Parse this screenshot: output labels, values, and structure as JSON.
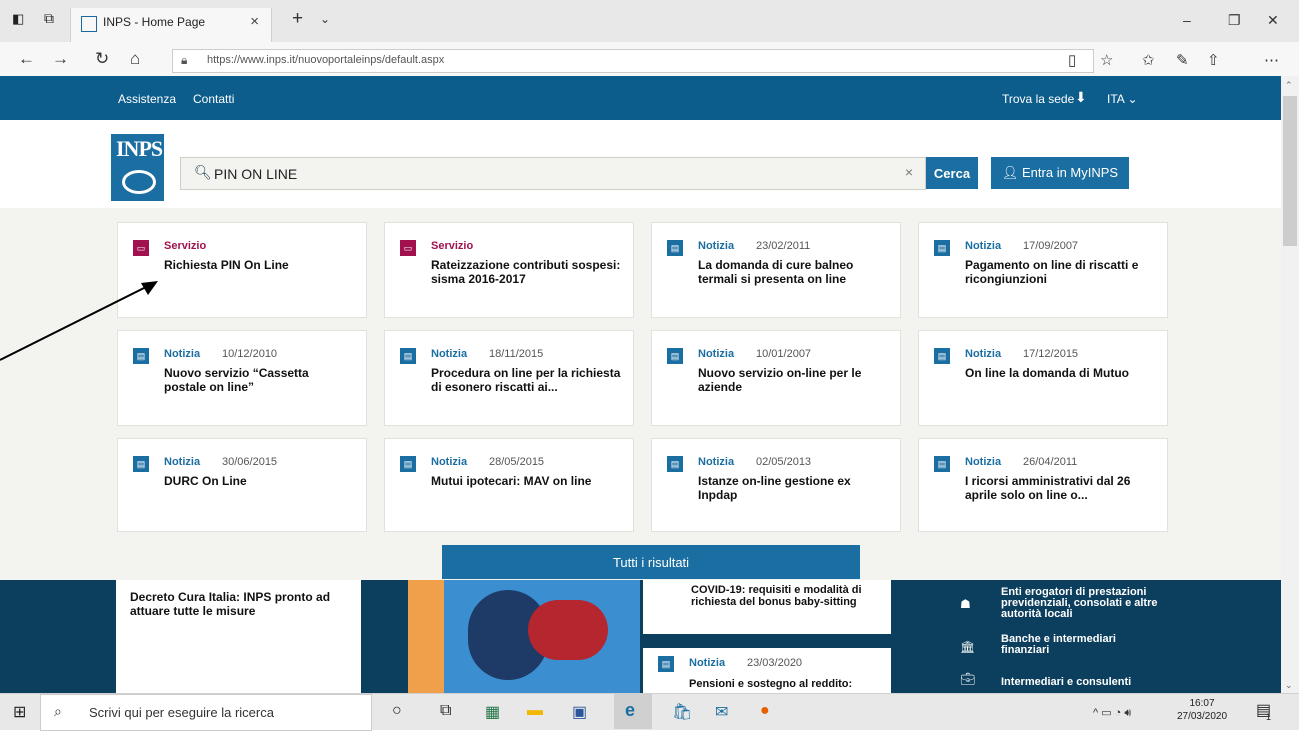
{
  "browser": {
    "tab_title": "INPS - Home Page",
    "url": "https://www.inps.it/nuovoportaleinps/default.aspx",
    "window_buttons": [
      "–",
      "❐",
      "✕"
    ]
  },
  "topnav": {
    "left_links": [
      "Assistenza",
      "Contatti"
    ],
    "trova_sede": "Trova la sede",
    "lang": "ITA"
  },
  "logo_text": "INPS",
  "search": {
    "value": "PIN ON LINE",
    "button_label": "Cerca",
    "login_label": "Entra in MyINPS"
  },
  "results": [
    {
      "type": "Servizio",
      "date": "",
      "title": "Richiesta PIN On Line"
    },
    {
      "type": "Servizio",
      "date": "",
      "title": "Rateizzazione contributi sospesi: sisma 2016-2017"
    },
    {
      "type": "Notizia",
      "date": "23/02/2011",
      "title": "La domanda di cure balneo termali si presenta on line"
    },
    {
      "type": "Notizia",
      "date": "17/09/2007",
      "title": "Pagamento on line di riscatti e ricongiunzioni"
    },
    {
      "type": "Notizia",
      "date": "10/12/2010",
      "title": "Nuovo servizio “Cassetta postale on line”"
    },
    {
      "type": "Notizia",
      "date": "18/11/2015",
      "title": "Procedura on line per la richiesta di esonero riscatti ai..."
    },
    {
      "type": "Notizia",
      "date": "10/01/2007",
      "title": "Nuovo servizio on-line per le aziende"
    },
    {
      "type": "Notizia",
      "date": "17/12/2015",
      "title": "On line la domanda di Mutuo"
    },
    {
      "type": "Notizia",
      "date": "30/06/2015",
      "title": "DURC On Line"
    },
    {
      "type": "Notizia",
      "date": "28/05/2015",
      "title": "Mutui ipotecari: MAV on line"
    },
    {
      "type": "Notizia",
      "date": "02/05/2013",
      "title": "Istanze on-line gestione ex Inpdap"
    },
    {
      "type": "Notizia",
      "date": "26/04/2011",
      "title": "I ricorsi amministrativi dal 26 aprile solo on line o..."
    }
  ],
  "all_results_label": "Tutti i risultati",
  "background_page": {
    "news1": "Decreto Cura Italia: INPS pronto ad attuare tutte le misure",
    "news2": "COVID-19: requisiti e modalità di richiesta del bonus baby-sitting",
    "news3_type": "Notizia",
    "news3_date": "23/03/2020",
    "news3_title": "Pensioni e sostegno al reddito:",
    "links": [
      "Enti erogatori di prestazioni previdenziali, consolati e altre autorità locali",
      "Banche e intermediari finanziari",
      "Intermediari e consulenti"
    ]
  },
  "taskbar": {
    "search_placeholder": "Scrivi qui per eseguire la ricerca",
    "time": "16:07",
    "date": "27/03/2020",
    "notification_count": "1"
  },
  "colors": {
    "brand_blue": "#1b6ea1",
    "topnav": "#0c5c8c",
    "servizio": "#a0114e"
  }
}
